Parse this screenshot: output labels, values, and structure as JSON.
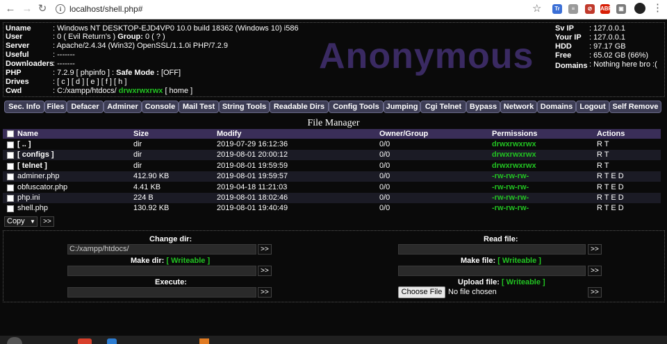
{
  "browser": {
    "url": "localhost/shell.php#",
    "info_icon": "info-icon",
    "extensions": [
      {
        "name": "ext-translate-icon",
        "color": "#3b6fd6",
        "text": "Tr"
      },
      {
        "name": "ext-doc-icon",
        "color": "#9a9a9a",
        "text": "≡"
      },
      {
        "name": "ext-block-icon",
        "color": "#c0392b",
        "text": "⊘"
      },
      {
        "name": "ext-abp-icon",
        "color": "#d81e05",
        "text": "ABP"
      },
      {
        "name": "ext-puzzle-icon",
        "color": "#7a7a7a",
        "text": "▣"
      },
      {
        "name": "ext-green-icon",
        "color": "#2e7d32",
        "text": "●"
      }
    ]
  },
  "sysinfo": {
    "labels": {
      "uname": "Uname",
      "user": "User",
      "server": "Server",
      "useful": "Useful",
      "downloaders": "Downloaders",
      "php": "PHP",
      "drives": "Drives",
      "cwd": "Cwd"
    },
    "uname": "Windows NT DESKTOP-EJD4VP0 10.0 build 18362 (Windows 10) i586",
    "user_value": "0 ( Evil Return's )",
    "group_label": "Group:",
    "group_value": "0 ( ? )",
    "server": "Apache/2.4.34 (Win32) OpenSSL/1.1.0i PHP/7.2.9",
    "useful": "-------",
    "downloaders": "-------",
    "php_version": "7.2.9 [ phpinfo ]",
    "safe_mode_label": "Safe Mode :",
    "safe_mode_value": "[OFF]",
    "drives": "[ c ] [ d ] [ e ] [ f ] [ h ]",
    "cwd_path": "C:/xampp/htdocs/",
    "cwd_perms": "drwxrwxrwx",
    "cwd_home": "[ home ]"
  },
  "logo_text": "Anonymous",
  "server_panel": {
    "labels": {
      "sv_ip": "Sv IP",
      "your_ip": "Your IP",
      "hdd": "HDD",
      "free": "Free",
      "domains": "Domains"
    },
    "sv_ip": "127.0.0.1",
    "your_ip": "127.0.0.1",
    "hdd": "97.17 GB",
    "free": "65.02 GB (66%)",
    "domains": "Nothing here bro :("
  },
  "menu": [
    "Sec. Info",
    "Files",
    "Defacer",
    "Adminer",
    "Console",
    "Mail Test",
    "String Tools",
    "Readable Dirs",
    "Config Tools",
    "Jumping",
    "Cgi Telnet",
    "Bypass",
    "Network",
    "Domains",
    "Logout",
    "Self Remove"
  ],
  "file_manager": {
    "title": "File Manager",
    "columns": [
      "Name",
      "Size",
      "Modify",
      "Owner/Group",
      "Permissions",
      "Actions"
    ],
    "rows": [
      {
        "name": "[ .. ]",
        "size": "dir",
        "modify": "2019-07-29 16:12:36",
        "owner": "0/0",
        "perms": "drwxrwxrwx",
        "actions": "R T"
      },
      {
        "name": "[ configs ]",
        "size": "dir",
        "modify": "2019-08-01 20:00:12",
        "owner": "0/0",
        "perms": "drwxrwxrwx",
        "actions": "R T"
      },
      {
        "name": "[ telnet ]",
        "size": "dir",
        "modify": "2019-08-01 19:59:59",
        "owner": "0/0",
        "perms": "drwxrwxrwx",
        "actions": "R T"
      },
      {
        "name": "adminer.php",
        "size": "412.90 KB",
        "modify": "2019-08-01 19:59:57",
        "owner": "0/0",
        "perms": "-rw-rw-rw-",
        "actions": "R T E D"
      },
      {
        "name": "obfuscator.php",
        "size": "4.41 KB",
        "modify": "2019-04-18 11:21:03",
        "owner": "0/0",
        "perms": "-rw-rw-rw-",
        "actions": "R T E D"
      },
      {
        "name": "php.ini",
        "size": "224 B",
        "modify": "2019-08-01 18:02:46",
        "owner": "0/0",
        "perms": "-rw-rw-rw-",
        "actions": "R T E D"
      },
      {
        "name": "shell.php",
        "size": "130.92 KB",
        "modify": "2019-08-01 19:40:49",
        "owner": "0/0",
        "perms": "-rw-rw-rw-",
        "actions": "R T E D"
      }
    ],
    "bulk_action": "Copy",
    "bulk_go": ">>"
  },
  "tools": {
    "change_dir_label": "Change dir:",
    "change_dir_value": "C:/xampp/htdocs/",
    "read_file_label": "Read file:",
    "make_dir_label": "Make dir:",
    "make_file_label": "Make file:",
    "writeable": "[ Writeable ]",
    "execute_label": "Execute:",
    "upload_label": "Upload file:",
    "choose_file": "Choose File",
    "no_file": "No file chosen",
    "go": ">>"
  },
  "colors": {
    "accent": "#3a2e58",
    "green": "#22c322",
    "logo": "#3a2a62"
  }
}
